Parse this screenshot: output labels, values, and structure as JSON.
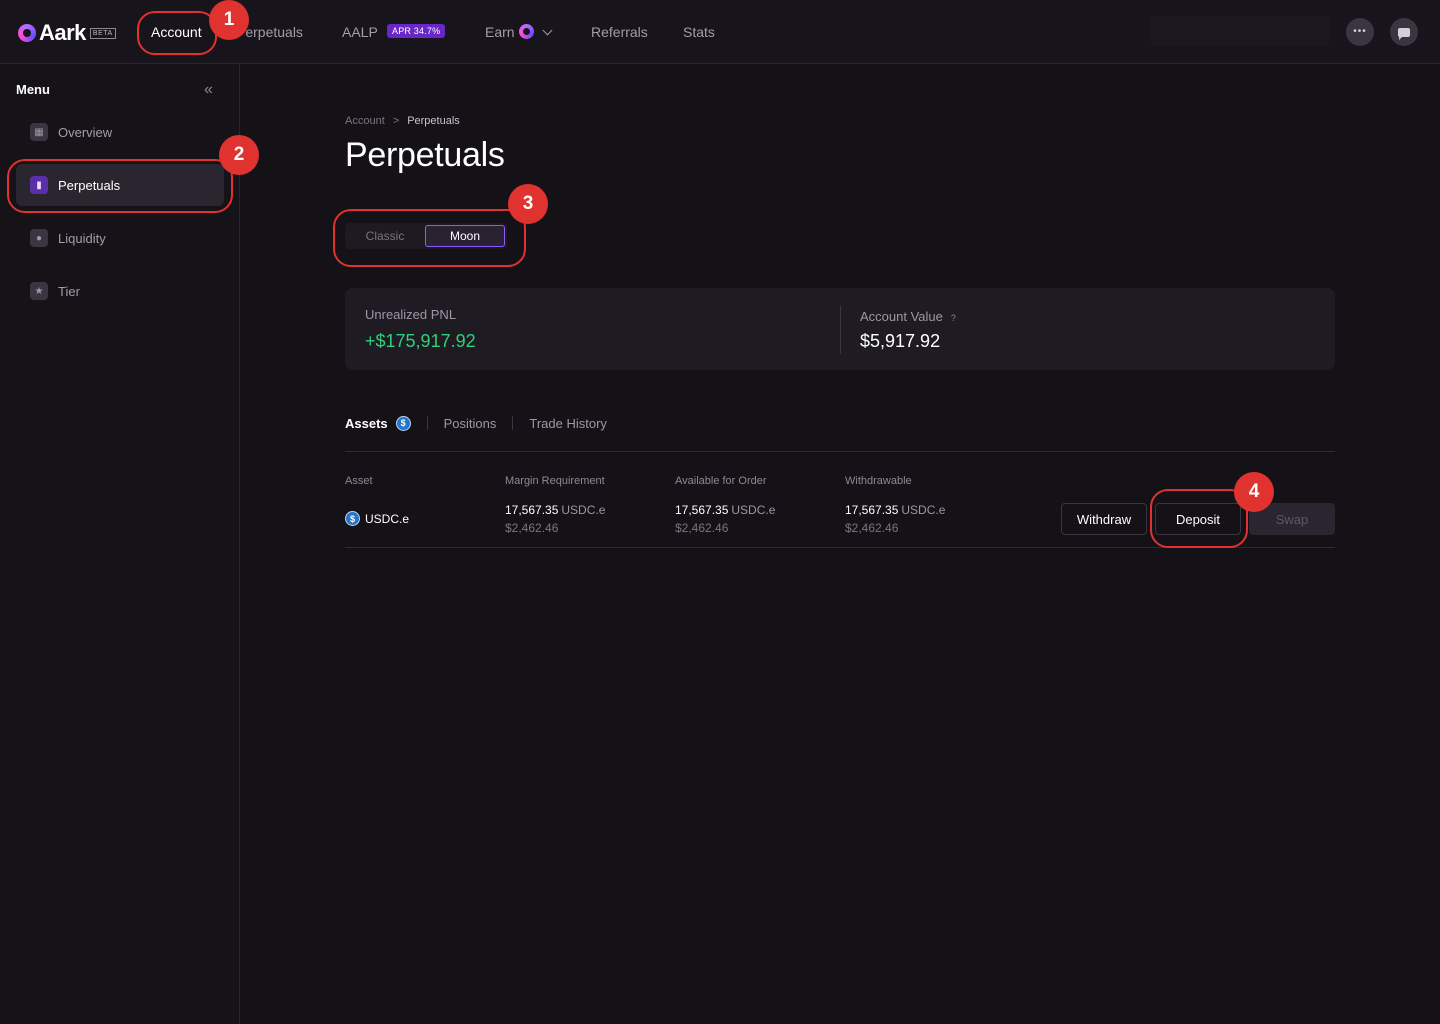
{
  "nav": {
    "logo_text": "Aark",
    "logo_badge": "BETA",
    "items": [
      "Account",
      "Perpetuals",
      "AALP",
      "Earn",
      "Referrals",
      "Stats"
    ],
    "apr_badge": "APR 34.7%",
    "more_icon": "•••"
  },
  "sidebar": {
    "title": "Menu",
    "collapse_icon": "«",
    "items": [
      {
        "label": "Overview",
        "icon": "grid-icon"
      },
      {
        "label": "Perpetuals",
        "icon": "bar-chart-icon"
      },
      {
        "label": "Liquidity",
        "icon": "drop-icon"
      },
      {
        "label": "Tier",
        "icon": "star-icon"
      }
    ]
  },
  "breadcrumb": {
    "root": "Account",
    "separator": ">",
    "current": "Perpetuals"
  },
  "page_title": "Perpetuals",
  "mode_toggle": {
    "options": [
      "Classic",
      "Moon"
    ],
    "selected": "Moon"
  },
  "summary": {
    "unrealized_pnl_label": "Unrealized PNL",
    "unrealized_pnl_value": "+$175,917.92",
    "account_value_label": "Account Value",
    "account_value_help": "?",
    "account_value": "$5,917.92"
  },
  "tabs": [
    "Assets",
    "Positions",
    "Trade History"
  ],
  "usdc_glyph": "$",
  "table": {
    "columns": [
      "Asset",
      "Margin Requirement",
      "Available for Order",
      "Withdrawable"
    ],
    "row": {
      "asset": "USDC.e",
      "margin_amount": "17,567.35",
      "margin_unit": "USDC.e",
      "margin_usd": "$2,462.46",
      "available_amount": "17,567.35",
      "available_unit": "USDC.e",
      "available_usd": "$2,462.46",
      "withdrawable_amount": "17,567.35",
      "withdrawable_unit": "USDC.e",
      "withdrawable_usd": "$2,462.46"
    },
    "actions": [
      "Withdraw",
      "Deposit",
      "Swap"
    ]
  },
  "annotations": [
    "1",
    "2",
    "3",
    "4"
  ],
  "colors": {
    "accent": "#8a5cff",
    "positive": "#2fd17a",
    "callout": "#e0322e",
    "background": "#141117"
  }
}
